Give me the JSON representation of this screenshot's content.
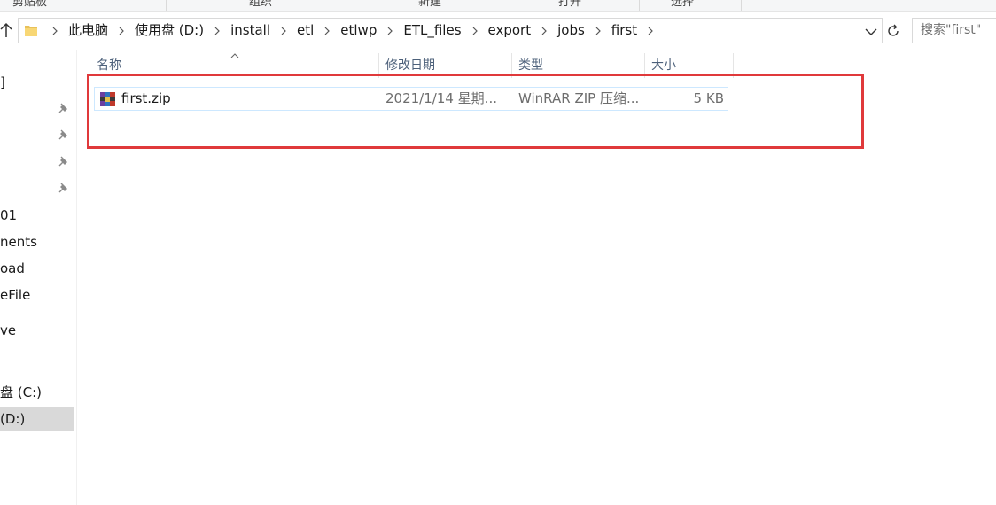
{
  "ribbon": {
    "groups": [
      "剪贴板",
      "组织",
      "新建",
      "打开",
      "选择"
    ]
  },
  "address": {
    "crumbs": [
      "此电脑",
      "使用盘 (D:)",
      "install",
      "etl",
      "etlwp",
      "ETL_files",
      "export",
      "jobs",
      "first"
    ],
    "search_placeholder": "搜索\"first\""
  },
  "nav": {
    "items": [
      "]",
      "01",
      "nents",
      "oad",
      "eFile",
      "ve",
      "盘 (C:)",
      " (D:)"
    ],
    "selected": " (D:)"
  },
  "columns": {
    "name": "名称",
    "date": "修改日期",
    "type": "类型",
    "size": "大小"
  },
  "files": [
    {
      "name": "first.zip",
      "date": "2021/1/14 星期...",
      "type": "WinRAR ZIP 压缩...",
      "size": "5 KB",
      "icon": "winrar-archive-icon"
    }
  ],
  "annotation": {
    "color": "#e0393b"
  }
}
